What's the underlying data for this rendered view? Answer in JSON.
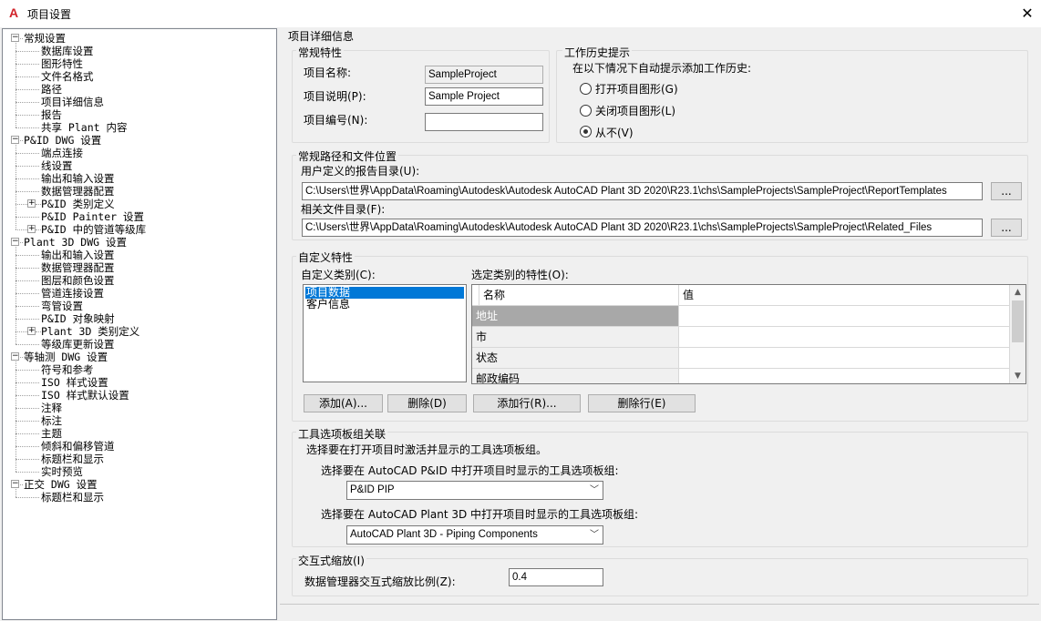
{
  "window": {
    "title": "项目设置",
    "app_icon": "A"
  },
  "tree": [
    {
      "label": "常规设置",
      "level": 0,
      "expander": "minus"
    },
    {
      "label": "数据库设置",
      "level": 1
    },
    {
      "label": "图形特性",
      "level": 1
    },
    {
      "label": "文件名格式",
      "level": 1
    },
    {
      "label": "路径",
      "level": 1
    },
    {
      "label": "项目详细信息",
      "level": 1
    },
    {
      "label": "报告",
      "level": 1
    },
    {
      "label": "共享 Plant 内容",
      "level": 1
    },
    {
      "label": "P&ID DWG 设置",
      "level": 0,
      "expander": "minus"
    },
    {
      "label": "端点连接",
      "level": 1
    },
    {
      "label": "线设置",
      "level": 1
    },
    {
      "label": "输出和输入设置",
      "level": 1
    },
    {
      "label": "数据管理器配置",
      "level": 1
    },
    {
      "label": "P&ID 类别定义",
      "level": 1,
      "expander": "plus"
    },
    {
      "label": "P&ID Painter 设置",
      "level": 1
    },
    {
      "label": "P&ID 中的管道等级库",
      "level": 1,
      "expander": "plus"
    },
    {
      "label": "Plant 3D DWG 设置",
      "level": 0,
      "expander": "minus"
    },
    {
      "label": "输出和输入设置",
      "level": 1
    },
    {
      "label": "数据管理器配置",
      "level": 1
    },
    {
      "label": "图层和颜色设置",
      "level": 1
    },
    {
      "label": "管道连接设置",
      "level": 1
    },
    {
      "label": "弯管设置",
      "level": 1
    },
    {
      "label": "P&ID 对象映射",
      "level": 1
    },
    {
      "label": "Plant 3D 类别定义",
      "level": 1,
      "expander": "plus"
    },
    {
      "label": "等级库更新设置",
      "level": 1
    },
    {
      "label": "等轴测 DWG 设置",
      "level": 0,
      "expander": "minus"
    },
    {
      "label": "符号和参考",
      "level": 1
    },
    {
      "label": "ISO 样式设置",
      "level": 1
    },
    {
      "label": "ISO 样式默认设置",
      "level": 1
    },
    {
      "label": "注释",
      "level": 1
    },
    {
      "label": "标注",
      "level": 1
    },
    {
      "label": "主题",
      "level": 1
    },
    {
      "label": "倾斜和偏移管道",
      "level": 1
    },
    {
      "label": "标题栏和显示",
      "level": 1
    },
    {
      "label": "实时预览",
      "level": 1
    },
    {
      "label": "正交 DWG 设置",
      "level": 0,
      "expander": "minus"
    },
    {
      "label": "标题栏和显示",
      "level": 1
    }
  ],
  "main": {
    "heading": "项目详细信息",
    "general": {
      "title": "常规特性",
      "name_label": "项目名称:",
      "name_value": "SampleProject",
      "desc_label": "项目说明(P):",
      "desc_value": "Sample Project",
      "number_label": "项目编号(N):",
      "number_value": ""
    },
    "history": {
      "title": "工作历史提示",
      "prompt": "在以下情况下自动提示添加工作历史:",
      "options": [
        "打开项目图形(G)",
        "关闭项目图形(L)",
        "从不(V)"
      ],
      "selected": 2
    },
    "paths": {
      "title": "常规路径和文件位置",
      "report_label": "用户定义的报告目录(U):",
      "report_value": "C:\\Users\\世界\\AppData\\Roaming\\Autodesk\\Autodesk AutoCAD Plant 3D 2020\\R23.1\\chs\\SampleProjects\\SampleProject\\ReportTemplates",
      "related_label": "相关文件目录(F):",
      "related_value": "C:\\Users\\世界\\AppData\\Roaming\\Autodesk\\Autodesk AutoCAD Plant 3D 2020\\R23.1\\chs\\SampleProjects\\SampleProject\\Related_Files",
      "browse_label": "..."
    },
    "custom": {
      "title": "自定义特性",
      "category_label": "自定义类别(C):",
      "categories": [
        "项目数据",
        "客户信息"
      ],
      "props_label": "选定类别的特性(O):",
      "col_name": "名称",
      "col_value": "值",
      "rows": [
        "地址",
        "市",
        "状态",
        "邮政编码"
      ],
      "buttons": [
        "添加(A)...",
        "删除(D)",
        "添加行(R)...",
        "删除行(E)"
      ]
    },
    "palettes": {
      "title": "工具选项板组关联",
      "desc": "选择要在打开项目时激活并显示的工具选项板组。",
      "pid_label": "选择要在 AutoCAD P&ID 中打开项目时显示的工具选项板组:",
      "pid_value": "P&ID PIP",
      "plant_label": "选择要在 AutoCAD Plant 3D 中打开项目时显示的工具选项板组:",
      "plant_value": "AutoCAD Plant 3D - Piping Components"
    },
    "zoom": {
      "title": "交互式缩放(I)",
      "label": "数据管理器交互式缩放比例(Z):",
      "value": "0.4"
    }
  }
}
